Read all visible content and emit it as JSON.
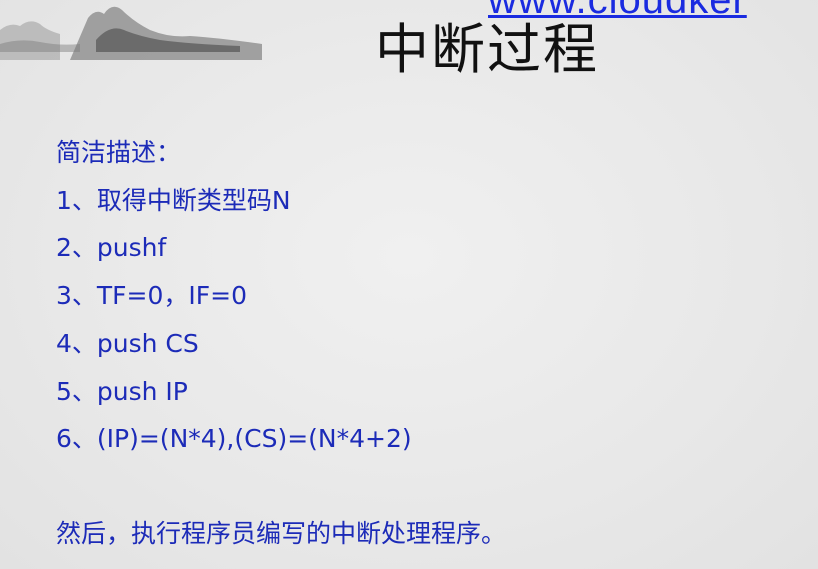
{
  "header": {
    "url_text": "www.cloudker",
    "title": "中断过程"
  },
  "body": {
    "intro": "简洁描述：",
    "steps": [
      {
        "num": "1、",
        "text": "取得中断类型码N"
      },
      {
        "num": "2、",
        "text": "pushf"
      },
      {
        "num": "3、",
        "text": "TF=0，IF=0"
      },
      {
        "num": "4、",
        "text": "push CS"
      },
      {
        "num": "5、",
        "text": "push IP"
      },
      {
        "num": "6、",
        "text": "(IP)=(N*4),(CS)=(N*4+2)"
      }
    ],
    "conclusion": "然后，执行程序员编写的中断处理程序。"
  },
  "colors": {
    "background": "#ebebeb",
    "title_text": "#111111",
    "body_text": "#1c2bb8",
    "link": "#1a2be0"
  },
  "decorations": {
    "top_left_art": "ink-mountain-landscape"
  }
}
